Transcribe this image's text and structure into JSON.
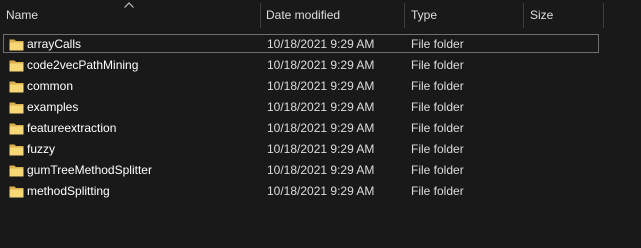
{
  "columns": {
    "name": "Name",
    "date_modified": "Date modified",
    "type": "Type",
    "size": "Size"
  },
  "sort": {
    "column": "name",
    "direction": "ascending",
    "icon": "chevron-up-icon"
  },
  "rows": [
    {
      "name": "arrayCalls",
      "date_modified": "10/18/2021 9:29 AM",
      "type": "File folder",
      "size": "",
      "icon": "folder-icon",
      "focused": true
    },
    {
      "name": "code2vecPathMining",
      "date_modified": "10/18/2021 9:29 AM",
      "type": "File folder",
      "size": "",
      "icon": "folder-icon"
    },
    {
      "name": "common",
      "date_modified": "10/18/2021 9:29 AM",
      "type": "File folder",
      "size": "",
      "icon": "folder-icon"
    },
    {
      "name": "examples",
      "date_modified": "10/18/2021 9:29 AM",
      "type": "File folder",
      "size": "",
      "icon": "folder-icon"
    },
    {
      "name": "featureextraction",
      "date_modified": "10/18/2021 9:29 AM",
      "type": "File folder",
      "size": "",
      "icon": "folder-icon"
    },
    {
      "name": "fuzzy",
      "date_modified": "10/18/2021 9:29 AM",
      "type": "File folder",
      "size": "",
      "icon": "folder-icon"
    },
    {
      "name": "gumTreeMethodSplitter",
      "date_modified": "10/18/2021 9:29 AM",
      "type": "File folder",
      "size": "",
      "icon": "folder-icon"
    },
    {
      "name": "methodSplitting",
      "date_modified": "10/18/2021 9:29 AM",
      "type": "File folder",
      "size": "",
      "icon": "folder-icon"
    }
  ],
  "colors": {
    "background": "#191919",
    "text": "#ffffff",
    "secondary_text": "#dcdcdc",
    "column_separator": "#3d3d3d",
    "focus_border": "#6f6f6f",
    "folder_yellow": "#f8d775"
  }
}
